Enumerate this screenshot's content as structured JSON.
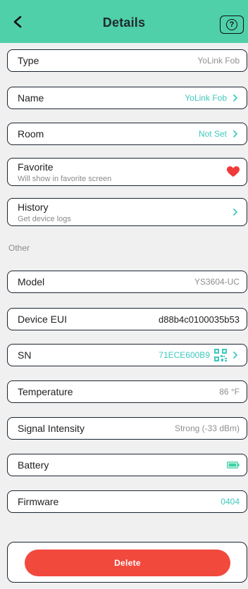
{
  "header": {
    "title": "Details"
  },
  "rows": {
    "type": {
      "label": "Type",
      "value": "YoLink Fob"
    },
    "name": {
      "label": "Name",
      "value": "YoLink Fob"
    },
    "room": {
      "label": "Room",
      "value": "Not Set"
    },
    "favorite": {
      "label": "Favorite",
      "sub": "Will show in favorite screen",
      "icon": "heart-icon",
      "color": "#ef3a3a"
    },
    "history": {
      "label": "History",
      "sub": "Get device logs"
    }
  },
  "section": {
    "label": "Other"
  },
  "other": {
    "model": {
      "label": "Model",
      "value": "YS3604-UC"
    },
    "device_eui": {
      "label": "Device EUI",
      "value": "d88b4c0100035b53"
    },
    "sn": {
      "label": "SN",
      "value": "71ECE600B9",
      "icon": "qr-code-icon"
    },
    "temperature": {
      "label": "Temperature",
      "value": "86 °F"
    },
    "signal": {
      "label": "Signal Intensity",
      "value": "Strong (-33 dBm)"
    },
    "battery": {
      "label": "Battery",
      "icon": "battery-full-icon",
      "color": "#3fd0a5"
    },
    "firmware": {
      "label": "Firmware",
      "value": "0404"
    }
  },
  "actions": {
    "delete_label": "Delete"
  },
  "colors": {
    "header": "#4fd0a8",
    "accent": "#3fc9bd",
    "danger": "#f2493d"
  }
}
